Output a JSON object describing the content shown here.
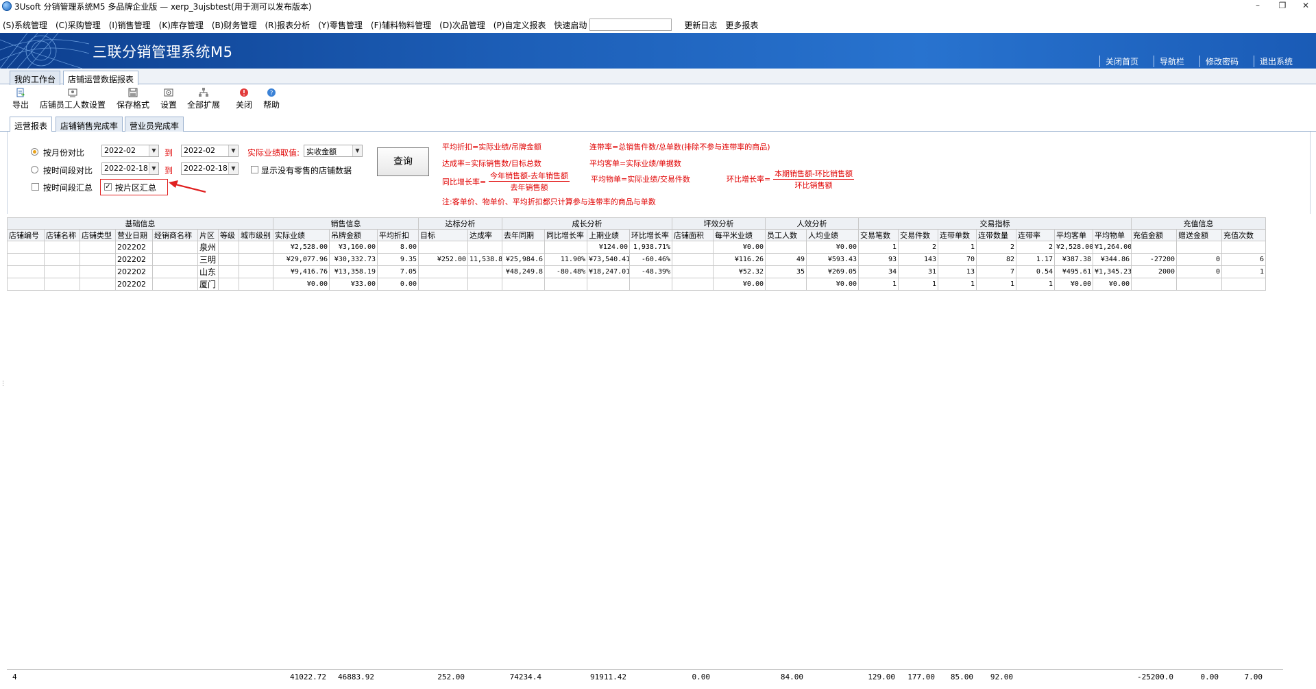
{
  "window": {
    "title": "3Usoft 分销管理系统M5 多品牌企业版 — xerp_3ujsbtest(用于测可以发布版本)",
    "controls": [
      "–",
      "❐",
      "✕"
    ]
  },
  "menu": {
    "items": [
      "(S)系统管理",
      "(C)采购管理",
      "(I)销售管理",
      "(K)库存管理",
      "(B)财务管理",
      "(R)报表分析",
      "(Y)零售管理",
      "(F)辅料物料管理",
      "(D)次品管理",
      "(P)自定义报表"
    ],
    "quick_label": "快速启动",
    "quick_value": "",
    "extra": [
      "更新日志",
      "更多报表"
    ]
  },
  "banner": {
    "brand": "三联分销管理系统M5",
    "links": [
      "关闭首页",
      "导航栏",
      "修改密码",
      "退出系统"
    ]
  },
  "main_tabs": [
    "我的工作台",
    "店铺运营数据报表"
  ],
  "toolbar": [
    {
      "label": "导出",
      "icon": "export-icon"
    },
    {
      "label": "店铺员工人数设置",
      "icon": "staff-settings-icon"
    },
    {
      "label": "保存格式",
      "icon": "save-format-icon"
    },
    {
      "label": "设置",
      "icon": "settings-icon"
    },
    {
      "label": "全部扩展",
      "icon": "expand-all-icon"
    },
    {
      "label": "关闭",
      "icon": "close-icon"
    },
    {
      "label": "帮助",
      "icon": "help-icon"
    }
  ],
  "sub_tabs": [
    "运营报表",
    "店铺销售完成率",
    "营业员完成率"
  ],
  "form": {
    "by_month": "按月份对比",
    "by_period": "按时间段对比",
    "by_period_sum": "按时间段汇总",
    "by_area_sum": "按片区汇总",
    "area_checked": "✓",
    "month_from": "2022-02",
    "month_to": "2022-02",
    "date_from": "2022-02-18",
    "date_to": "2022-02-18",
    "to_label": "到",
    "actual_label": "实际业绩取值:",
    "actual_value": "实收金额",
    "show_no_sales": "显示没有零售的店铺数据",
    "query_button": "查询"
  },
  "formulas": {
    "avg_discount": "平均折扣=实际业绩/吊牌金额",
    "attach_rate": "连带率=总销售件数/总单数(排除不参与连带率的商品)",
    "achieve_rate": "达成率=实际销售数/目标总数",
    "avg_ticket": "平均客单=实际业绩/单据数",
    "yoy_label": "同比增长率=",
    "yoy_num": "今年销售额-去年销售额",
    "yoy_den": "去年销售额",
    "avg_item": "平均物单=实际业绩/交易件数",
    "mom_label": "环比增长率=",
    "mom_num": "本期销售额-环比销售额",
    "mom_den": "环比销售额",
    "note": "注:客单价、物单价、平均折扣都只计算参与连带率的商品与单数"
  },
  "grid": {
    "groups": [
      "基础信息",
      "销售信息",
      "达标分析",
      "成长分析",
      "坪效分析",
      "人效分析",
      "交易指标",
      "充值信息"
    ],
    "columns": [
      "店铺编号",
      "店铺名称",
      "店铺类型",
      "营业日期",
      "经销商名称",
      "片区",
      "等级",
      "城市级别",
      "实际业绩",
      "吊牌金额",
      "平均折扣",
      "目标",
      "达成率",
      "去年同期",
      "同比增长率",
      "上期业绩",
      "环比增长率",
      "店铺面积",
      "每平米业绩",
      "员工人数",
      "人均业绩",
      "交易笔数",
      "交易件数",
      "连带单数",
      "连带数量",
      "连带率",
      "平均客单",
      "平均物单",
      "充值金额",
      "赠送金额",
      "充值次数"
    ],
    "rows": [
      [
        "",
        "",
        "",
        "202202",
        "",
        "泉州",
        "",
        "",
        "¥2,528.00",
        "¥3,160.00",
        "8.00",
        "",
        "",
        "",
        "",
        "¥124.00",
        "1,938.71%",
        "",
        "¥0.00",
        "",
        "¥0.00",
        "1",
        "2",
        "1",
        "2",
        "2",
        "¥2,528.00",
        "¥1,264.00",
        "",
        "",
        ""
      ],
      [
        "",
        "",
        "",
        "202202",
        "",
        "三明",
        "",
        "",
        "¥29,077.96",
        "¥30,332.73",
        "9.35",
        "¥252.00",
        "11,538.8",
        "¥25,984.6",
        "11.90%",
        "¥73,540.41",
        "-60.46%",
        "",
        "¥116.26",
        "49",
        "¥593.43",
        "93",
        "143",
        "70",
        "82",
        "1.17",
        "¥387.38",
        "¥344.86",
        "-27200",
        "0",
        "6"
      ],
      [
        "",
        "",
        "",
        "202202",
        "",
        "山东",
        "",
        "",
        "¥9,416.76",
        "¥13,358.19",
        "7.05",
        "",
        "",
        "¥48,249.8",
        "-80.48%",
        "¥18,247.01",
        "-48.39%",
        "",
        "¥52.32",
        "35",
        "¥269.05",
        "34",
        "31",
        "13",
        "7",
        "0.54",
        "¥495.61",
        "¥1,345.23",
        "2000",
        "0",
        "1"
      ],
      [
        "",
        "",
        "",
        "202202",
        "",
        "厦门",
        "",
        "",
        "¥0.00",
        "¥33.00",
        "0.00",
        "",
        "",
        "",
        "",
        "",
        "",
        "",
        "¥0.00",
        "",
        "¥0.00",
        "1",
        "1",
        "1",
        "1",
        "1",
        "¥0.00",
        "¥0.00",
        "",
        "",
        ""
      ]
    ]
  },
  "footer": {
    "count": "4",
    "totals": [
      "41022.72",
      "46883.92",
      "252.00",
      "74234.4",
      "91911.42",
      "0.00",
      "84.00",
      "129.00",
      "177.00",
      "85.00",
      "92.00",
      "-25200.0",
      "0.00",
      "7.00"
    ]
  }
}
